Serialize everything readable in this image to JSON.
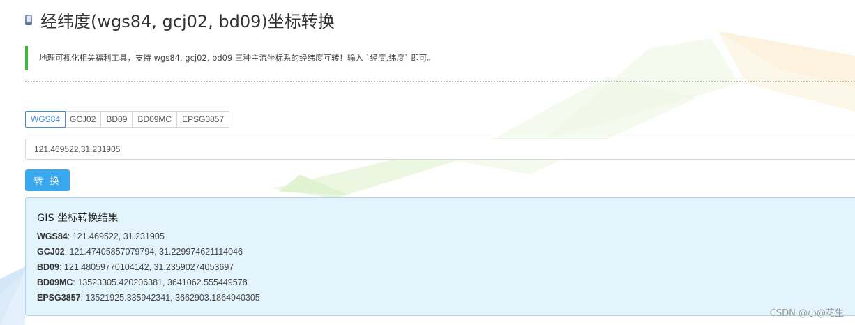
{
  "header": {
    "title": "经纬度(wgs84, gcj02, bd09)坐标转换",
    "icon": "document-icon"
  },
  "description": {
    "text": "地理可视化相关福利工具，支持 wgs84, gcj02, bd09 三种主流坐标系的经纬度互转！输入 `经度,纬度` 即可。",
    "accent_color": "#3db83a"
  },
  "tabs": [
    {
      "label": "WGS84",
      "active": true
    },
    {
      "label": "GCJ02",
      "active": false
    },
    {
      "label": "BD09",
      "active": false
    },
    {
      "label": "BD09MC",
      "active": false
    },
    {
      "label": "EPSG3857",
      "active": false
    }
  ],
  "input": {
    "value": "121.469522,31.231905",
    "placeholder": ""
  },
  "convert_button": {
    "label": "转 换",
    "color": "#3aa8ef"
  },
  "result": {
    "title": "GIS 坐标转换结果",
    "rows": [
      {
        "label": "WGS84",
        "value": ": 121.469522, 31.231905"
      },
      {
        "label": "GCJ02",
        "value": ": 121.47405857079794, 31.229974621114046"
      },
      {
        "label": "BD09",
        "value": ": 121.48059770104142, 31.23590274053697"
      },
      {
        "label": "BD09MC",
        "value": ": 13523305.420206381, 3641062.555449578"
      },
      {
        "label": "EPSG3857",
        "value": ": 13521925.335942341, 3662903.1864940305"
      }
    ]
  },
  "watermark": "CSDN @小@花生"
}
